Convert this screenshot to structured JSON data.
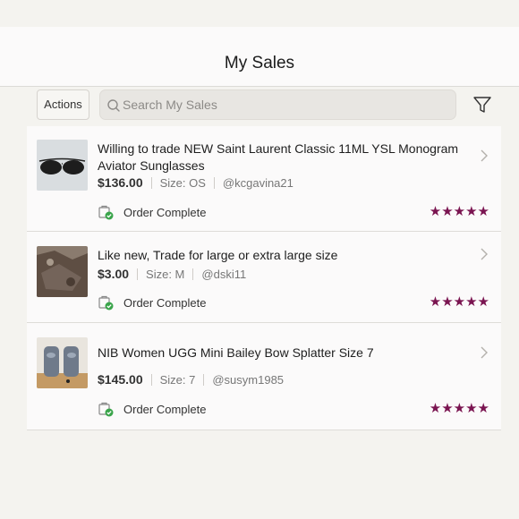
{
  "header": {
    "title": "My Sales"
  },
  "toolbar": {
    "actions_label": "Actions",
    "search_placeholder": "Search My Sales",
    "filter_icon": "filter-icon"
  },
  "sales": [
    {
      "title": "Willing to trade NEW Saint Laurent Classic 11ML YSL Monogram Aviator Sunglasses",
      "price": "$136.00",
      "size": "Size: OS",
      "buyer": "@kcgavina21",
      "status": "Order Complete",
      "rating": 5,
      "stars": "★★★★★"
    },
    {
      "title": "Like new, Trade for large or extra large size",
      "price": "$3.00",
      "size": "Size: M",
      "buyer": "@dski11",
      "status": "Order Complete",
      "rating": 5,
      "stars": "★★★★★"
    },
    {
      "title": "NIB Women UGG Mini Bailey Bow Splatter Size 7",
      "price": "$145.00",
      "size": "Size: 7",
      "buyer": "@susym1985",
      "status": "Order Complete",
      "rating": 5,
      "stars": "★★★★★"
    }
  ],
  "colors": {
    "star": "#7a1450",
    "status_check": "#3aa44a",
    "background": "#f4f3ef"
  }
}
